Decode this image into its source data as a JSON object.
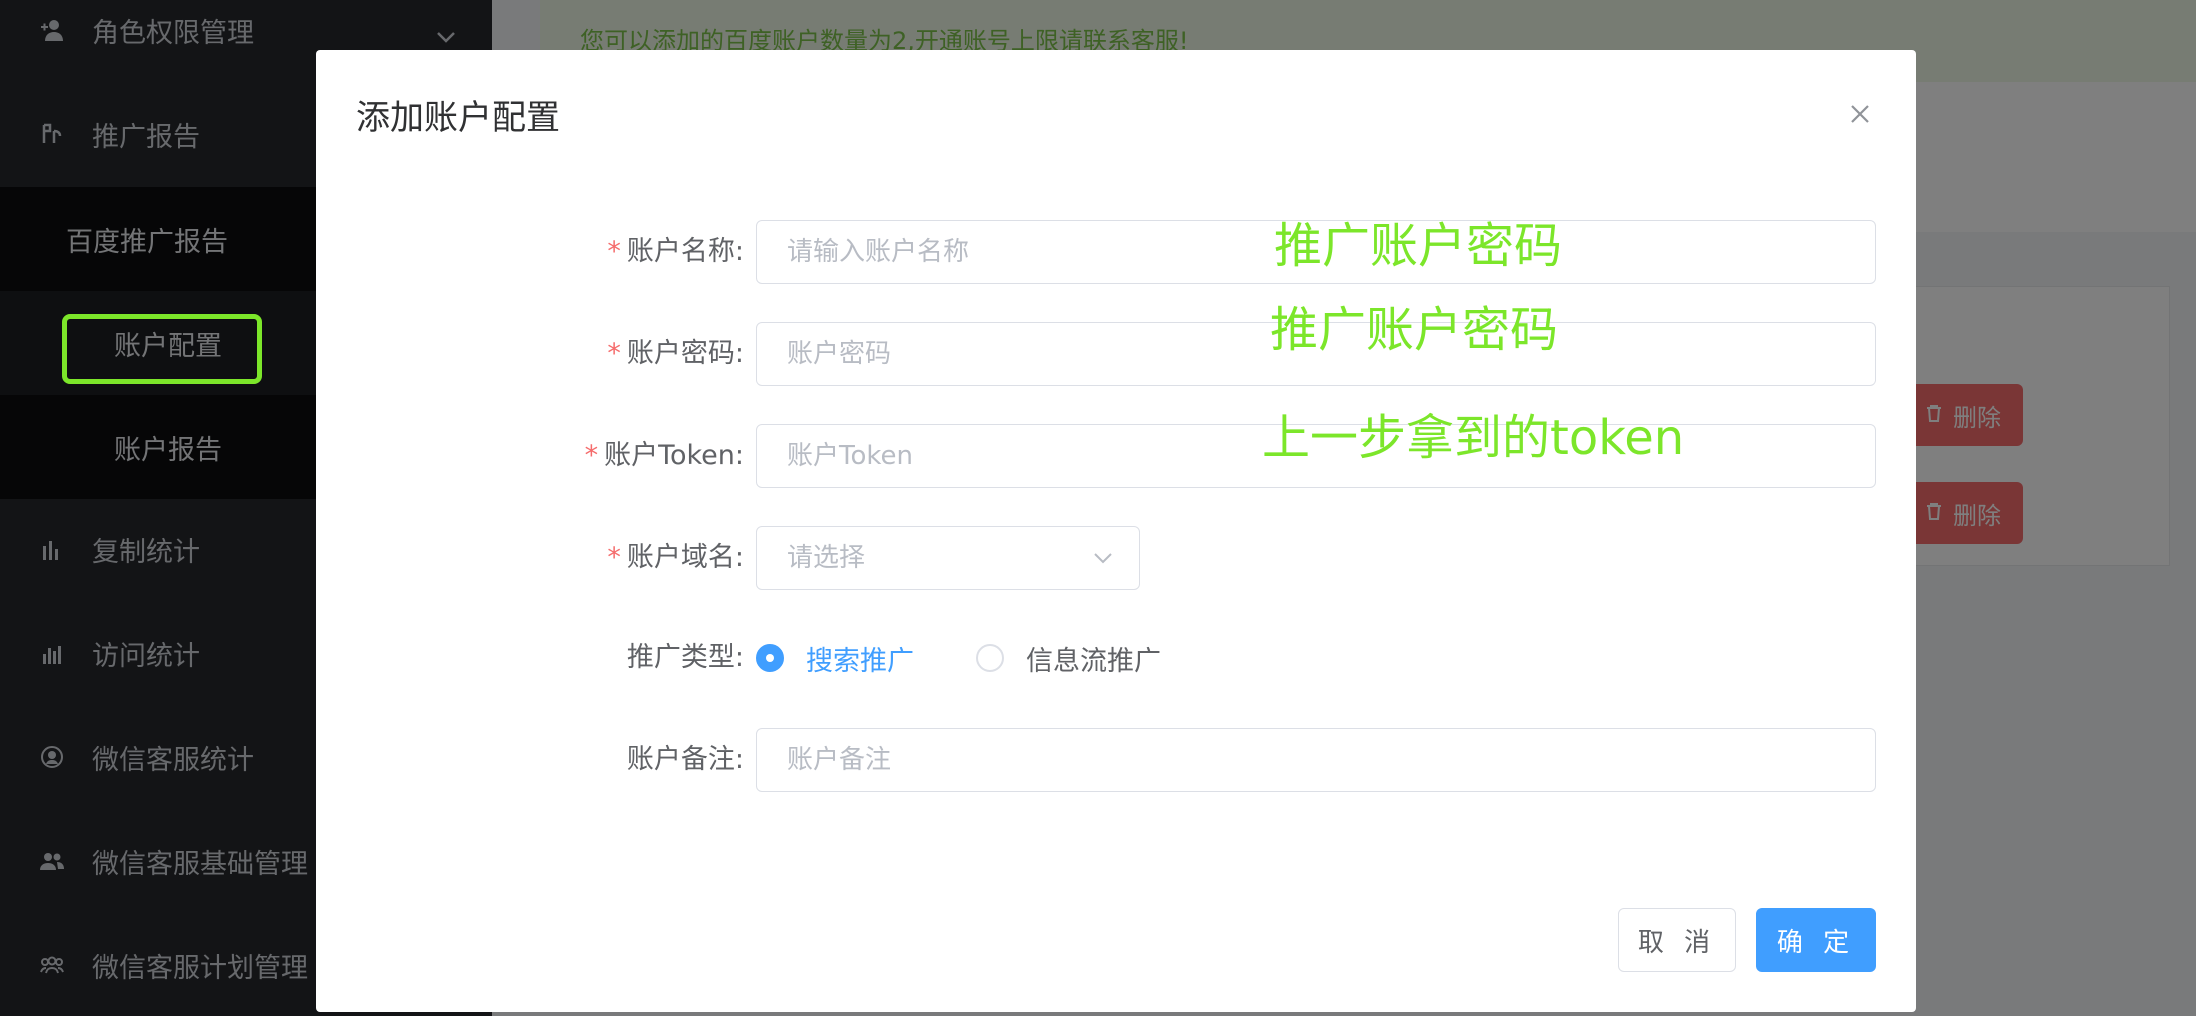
{
  "sidebar": {
    "items": [
      {
        "label": "角色权限管理",
        "icon": "user-add-icon"
      },
      {
        "label": "推广报告",
        "icon": "report-icon"
      },
      {
        "label": "复制统计",
        "icon": "bar-chart-icon"
      },
      {
        "label": "访问统计",
        "icon": "stats-icon"
      },
      {
        "label": "微信客服统计",
        "icon": "support-icon"
      },
      {
        "label": "微信客服基础管理",
        "icon": "group-icon"
      },
      {
        "label": "微信客服计划管理",
        "icon": "team-icon"
      }
    ],
    "submenu": {
      "parent": "百度推广报告",
      "items": [
        {
          "label": "账户配置"
        },
        {
          "label": "账户报告"
        }
      ]
    }
  },
  "main": {
    "notice": "您可以添加的百度账户数量为2,开通账号上限请联系客服!",
    "delete_label": "删除"
  },
  "dialog": {
    "title": "添加账户配置",
    "fields": {
      "name": {
        "label": "账户名称:",
        "placeholder": "请输入账户名称"
      },
      "password": {
        "label": "账户密码:",
        "placeholder": "账户密码"
      },
      "token": {
        "label": "账户Token:",
        "placeholder": "账户Token"
      },
      "domain": {
        "label": "账户域名:",
        "placeholder": "请选择"
      },
      "promo_type": {
        "label": "推广类型:",
        "options": [
          "搜索推广",
          "信息流推广"
        ],
        "selected": "搜索推广"
      },
      "remark": {
        "label": "账户备注:",
        "placeholder": "账户备注"
      }
    },
    "cancel_label": "取 消",
    "ok_label": "确 定"
  },
  "annotations": [
    "推广账户密码",
    "推广账户密码",
    "上一步拿到的token"
  ],
  "colors": {
    "primary": "#409eff",
    "danger": "#f56c6c",
    "annotation": "#7ce62a",
    "sidebar_bg": "#26282d"
  }
}
